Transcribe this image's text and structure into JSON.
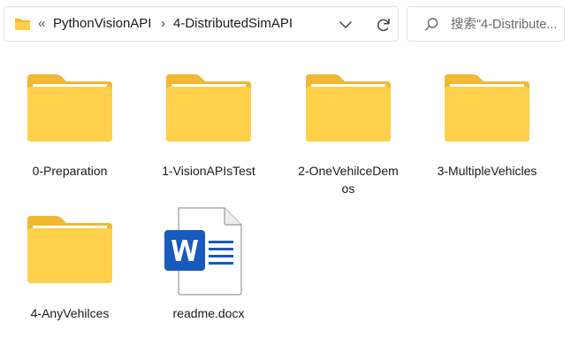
{
  "address_bar": {
    "overflow_chevrons": "«",
    "breadcrumbs": [
      "PythonVisionAPI",
      "4-DistributedSimAPI"
    ],
    "separator": "›",
    "icons": {
      "location": "folder-icon",
      "dropdown": "chevron-down-icon",
      "refresh": "refresh-icon"
    }
  },
  "search": {
    "placeholder": "搜索\"4-Distribute...",
    "icon": "search-icon"
  },
  "files": [
    {
      "name": "0-Preparation",
      "type": "folder"
    },
    {
      "name": "1-VisionAPIsTest",
      "type": "folder"
    },
    {
      "name": "2-OneVehilceDemos",
      "type": "folder"
    },
    {
      "name": "3-MultipleVehicles",
      "type": "folder"
    },
    {
      "name": "4-AnyVehilces",
      "type": "folder"
    },
    {
      "name": "readme.docx",
      "type": "word-document"
    }
  ],
  "colors": {
    "folder_front": "#FFD04A",
    "folder_back": "#F2B733",
    "word_blue": "#185ABD",
    "border": "#E3E3E3"
  }
}
